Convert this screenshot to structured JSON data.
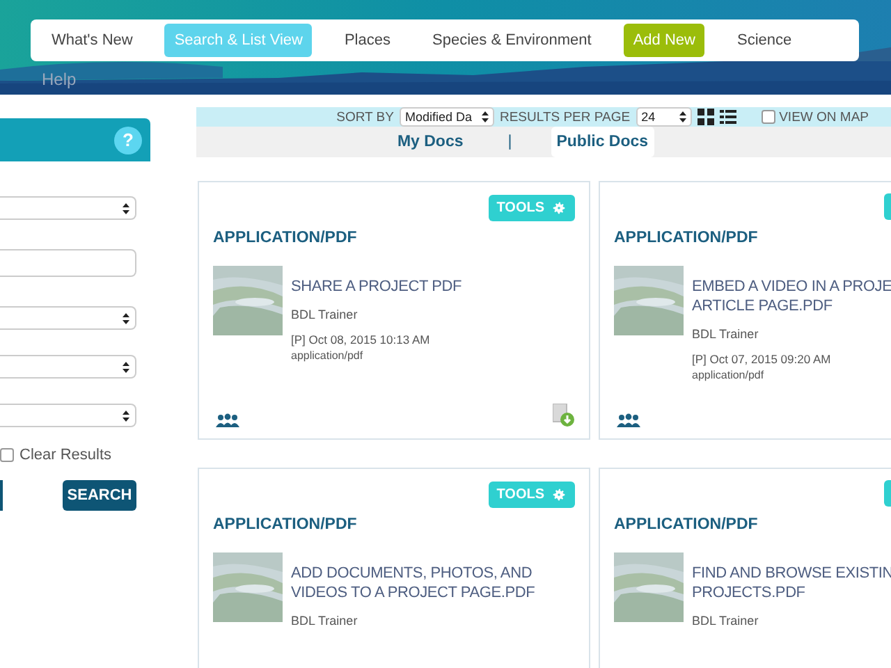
{
  "nav": {
    "items": [
      {
        "label": "What's New",
        "selected": false,
        "kind": "link"
      },
      {
        "label": "Search & List View",
        "selected": true,
        "kind": "link"
      },
      {
        "label": "Places",
        "selected": false,
        "kind": "link"
      },
      {
        "label": "Species & Environment",
        "selected": false,
        "kind": "link"
      },
      {
        "label": "Add New",
        "selected": false,
        "kind": "action"
      },
      {
        "label": "Science",
        "selected": false,
        "kind": "link"
      }
    ],
    "help": "Help"
  },
  "sidebar": {
    "help_icon": "?",
    "fields": [
      {
        "kind": "select"
      },
      {
        "kind": "input"
      },
      {
        "kind": "select"
      },
      {
        "kind": "select"
      },
      {
        "kind": "select"
      }
    ],
    "clear_results": {
      "label": "Clear Results",
      "checked": false
    },
    "search_button": "SEARCH"
  },
  "toolbar": {
    "sort_label": "SORT BY",
    "sort_value": "Modified Da",
    "per_page_label": "RESULTS PER PAGE",
    "per_page_value": "24",
    "view_on_map": {
      "label": "VIEW ON MAP",
      "checked": false
    }
  },
  "doc_tabs": [
    {
      "label": "My Docs",
      "selected": false
    },
    {
      "label": "Public Docs",
      "selected": true
    }
  ],
  "doc_tab_separator": "|",
  "cards": [
    {
      "tools": "TOOLS",
      "type": "APPLICATION/PDF",
      "title_lines": [
        "SHARE A PROJECT PDF"
      ],
      "author": "BDL Trainer",
      "date": "[P] Oct 08, 2015 10:13 AM",
      "mime": "application/pdf",
      "shared": true,
      "download": true
    },
    {
      "type": "APPLICATION/PDF",
      "title_lines": [
        "EMBED A VIDEO IN A PROJE",
        "ARTICLE PAGE.PDF"
      ],
      "author": "BDL Trainer",
      "date": "[P] Oct 07, 2015 09:20 AM",
      "mime": "application/pdf",
      "shared": true
    },
    {
      "tools": "TOOLS",
      "type": "APPLICATION/PDF",
      "title_lines": [
        "ADD DOCUMENTS, PHOTOS, AND",
        "VIDEOS TO A PROJECT PAGE.PDF"
      ],
      "author": "BDL Trainer"
    },
    {
      "type": "APPLICATION/PDF",
      "title_lines": [
        "FIND AND BROWSE EXISTIN",
        "PROJECTS.PDF"
      ],
      "author": "BDL Trainer"
    }
  ]
}
